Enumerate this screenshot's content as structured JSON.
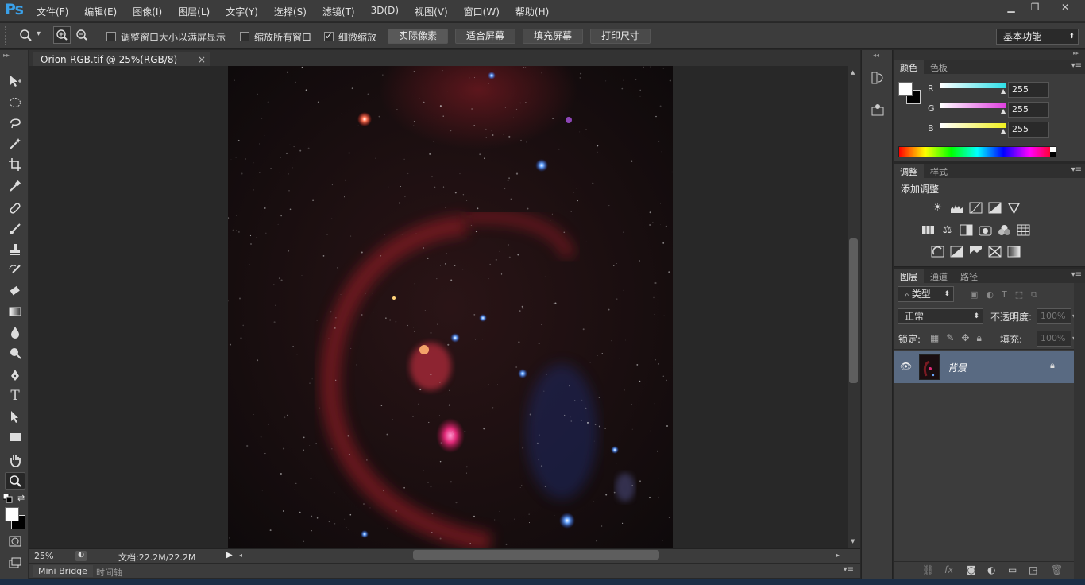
{
  "app": {
    "logo": "Ps"
  },
  "menu": [
    "文件(F)",
    "编辑(E)",
    "图像(I)",
    "图层(L)",
    "文字(Y)",
    "选择(S)",
    "滤镜(T)",
    "3D(D)",
    "视图(V)",
    "窗口(W)",
    "帮助(H)"
  ],
  "window_controls": {
    "minimize": "▁",
    "restore": "❐",
    "close": "✕"
  },
  "options": {
    "zoom_dropdown_arrow": "▾",
    "resize_windows": "调整窗口大小以满屏显示",
    "zoom_all": "缩放所有窗口",
    "scrubby_zoom": "细微缩放",
    "actual_pixels": "实际像素",
    "fit_screen": "适合屏幕",
    "fill_screen": "填充屏幕",
    "print_size": "打印尺寸",
    "workspace": "基本功能"
  },
  "document": {
    "tab_title": "Orion-RGB.tif @ 25%(RGB/8)",
    "zoom": "25%",
    "doc_size": "文档:22.2M/22.2M"
  },
  "bottom_tabs": [
    "Mini Bridge",
    "时间轴"
  ],
  "color_panel": {
    "tabs": [
      "颜色",
      "色板"
    ],
    "channels": [
      {
        "label": "R",
        "value": "255",
        "color": "#2fe0e8"
      },
      {
        "label": "G",
        "value": "255",
        "color": "#e040e0"
      },
      {
        "label": "B",
        "value": "255",
        "color": "#f0f020"
      }
    ]
  },
  "adjust_panel": {
    "tabs": [
      "调整",
      "样式"
    ],
    "title": "添加调整"
  },
  "layers_panel": {
    "tabs": [
      "图层",
      "通道",
      "路径"
    ],
    "filter_kind": "类型",
    "blend_mode": "正常",
    "opacity_label": "不透明度:",
    "opacity_value": "100%",
    "lock_label": "锁定:",
    "fill_label": "填充:",
    "fill_value": "100%",
    "layer_name": "背景"
  },
  "colors": {
    "accent": "#3aa0e8",
    "ui_bg": "#3c3c3c",
    "layer_selected": "#596a82"
  }
}
